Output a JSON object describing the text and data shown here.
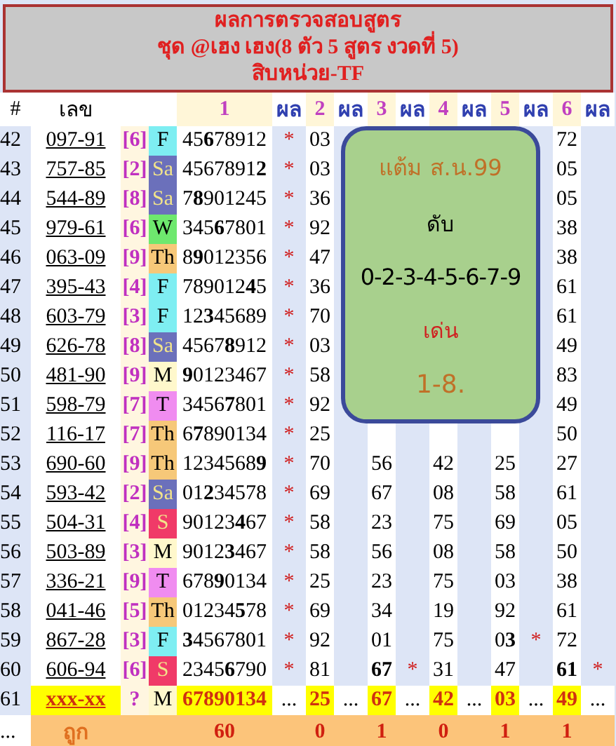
{
  "title_lines": [
    "ผลการตรวจสอบสูตร",
    "ชุด @เฮง เฮง(8 ตัว 5 สูตร งวดที่ 5)",
    "สิบหน่วย-TF"
  ],
  "header": [
    "#",
    "เลข",
    "1",
    "ผล",
    "2",
    "ผล",
    "3",
    "ผล",
    "4",
    "ผล",
    "5",
    "ผล",
    "6",
    "ผล"
  ],
  "rows": [
    {
      "kind": "result",
      "no": "42",
      "number": "097-91",
      "group": "[6]",
      "day": {
        "label": "F",
        "color": "#7eeef2"
      },
      "digits": "45**6**78912",
      "mark": "*",
      "r2": {
        "value": "03"
      },
      "r6": {
        "value": "72"
      }
    },
    {
      "kind": "result",
      "no": "43",
      "number": "757-85",
      "group": "[2]",
      "day": {
        "label": "Sa",
        "color": "#6b70bb"
      },
      "digits": "4567891**2**",
      "mark": "*",
      "r2": {
        "value": "03"
      },
      "r6": {
        "value": "05"
      }
    },
    {
      "kind": "result",
      "no": "44",
      "number": "544-89",
      "group": "[8]",
      "day": {
        "label": "Sa",
        "color": "#6b70bb"
      },
      "digits": "7**8**901245",
      "mark": "*",
      "r2": {
        "value": "36"
      },
      "r6": {
        "value": "05"
      }
    },
    {
      "kind": "result",
      "no": "45",
      "number": "979-61",
      "group": "[6]",
      "day": {
        "label": "W",
        "color": "#6ee86e"
      },
      "digits": "345**6**7801",
      "mark": "*",
      "r2": {
        "value": "92"
      },
      "r6": {
        "value": "38"
      }
    },
    {
      "kind": "result",
      "no": "46",
      "number": "063-09",
      "group": "[9]",
      "day": {
        "label": "Th",
        "color": "#f6c879"
      },
      "digits": "8**9**012356",
      "mark": "*",
      "r2": {
        "value": "47"
      },
      "r6": {
        "value": "38"
      }
    },
    {
      "kind": "result",
      "no": "47",
      "number": "395-43",
      "group": "[4]",
      "day": {
        "label": "F",
        "color": "#7eeef2"
      },
      "digits": "789012**4**5",
      "mark": "*",
      "r2": {
        "value": "36"
      },
      "r6": {
        "value": "61"
      }
    },
    {
      "kind": "result",
      "no": "48",
      "number": "603-79",
      "group": "[3]",
      "day": {
        "label": "F",
        "color": "#7eeef2"
      },
      "digits": "12**3**45689",
      "mark": "*",
      "r2": {
        "value": "70"
      },
      "r6": {
        "value": "61"
      }
    },
    {
      "kind": "result",
      "no": "49",
      "number": "626-78",
      "group": "[8]",
      "day": {
        "label": "Sa",
        "color": "#6b70bb"
      },
      "digits": "4567**8**912",
      "mark": "*",
      "r2": {
        "value": "03"
      },
      "r6": {
        "value": "49"
      }
    },
    {
      "kind": "result",
      "no": "50",
      "number": "481-90",
      "group": "[9]",
      "day": {
        "label": "M",
        "color": "#fff8cc"
      },
      "digits": "**9**0123467",
      "mark": "*",
      "r2": {
        "value": "58"
      },
      "r6": {
        "value": "83"
      }
    },
    {
      "kind": "result",
      "no": "51",
      "number": "598-79",
      "group": "[7]",
      "day": {
        "label": "T",
        "color": "#f08cf0"
      },
      "digits": "3456**7**801",
      "mark": "*",
      "r2": {
        "value": "92"
      },
      "r6": {
        "value": "49"
      }
    },
    {
      "kind": "result",
      "no": "52",
      "number": "116-17",
      "group": "[7]",
      "day": {
        "label": "Th",
        "color": "#f6c879"
      },
      "digits": "6**7**890134",
      "mark": "*",
      "r2": {
        "value": "25"
      },
      "r6": {
        "value": "50"
      }
    },
    {
      "kind": "result",
      "no": "53",
      "number": "690-60",
      "group": "[9]",
      "day": {
        "label": "Th",
        "color": "#f6c879"
      },
      "digits": "1234568**9**",
      "mark": "*",
      "r2": {
        "value": "70"
      },
      "r3": {
        "value": "56"
      },
      "r4": {
        "value": "42"
      },
      "r5": {
        "value": "25"
      },
      "r6": {
        "value": "27"
      }
    },
    {
      "kind": "result",
      "no": "54",
      "number": "593-42",
      "group": "[2]",
      "day": {
        "label": "Sa",
        "color": "#6b70bb"
      },
      "digits": "01**2**34578",
      "mark": "*",
      "r2": {
        "value": "69"
      },
      "r3": {
        "value": "67"
      },
      "r4": {
        "value": "08"
      },
      "r5": {
        "value": "58"
      },
      "r6": {
        "value": "61"
      }
    },
    {
      "kind": "result",
      "no": "55",
      "number": "504-31",
      "group": "[4]",
      "day": {
        "label": "S",
        "color": "#f03a68"
      },
      "digits": "90123**4**67",
      "mark": "*",
      "r2": {
        "value": "58"
      },
      "r3": {
        "value": "23"
      },
      "r4": {
        "value": "75"
      },
      "r5": {
        "value": "69"
      },
      "r6": {
        "value": "05"
      }
    },
    {
      "kind": "result",
      "no": "56",
      "number": "503-89",
      "group": "[3]",
      "day": {
        "label": "M",
        "color": "#fff8cc"
      },
      "digits": "9012**3**467",
      "mark": "*",
      "r2": {
        "value": "58"
      },
      "r3": {
        "value": "56"
      },
      "r4": {
        "value": "08"
      },
      "r5": {
        "value": "58"
      },
      "r6": {
        "value": "50"
      }
    },
    {
      "kind": "result",
      "no": "57",
      "number": "336-21",
      "group": "[9]",
      "day": {
        "label": "T",
        "color": "#f08cf0"
      },
      "digits": "678**9**0134",
      "mark": "*",
      "r2": {
        "value": "25"
      },
      "r3": {
        "value": "23"
      },
      "r4": {
        "value": "75"
      },
      "r5": {
        "value": "03"
      },
      "r6": {
        "value": "38"
      }
    },
    {
      "kind": "result",
      "no": "58",
      "number": "041-46",
      "group": "[5]",
      "day": {
        "label": "Th",
        "color": "#f6c879"
      },
      "digits": "01234**5**78",
      "mark": "*",
      "r2": {
        "value": "69"
      },
      "r3": {
        "value": "34"
      },
      "r4": {
        "value": "19"
      },
      "r5": {
        "value": "92"
      },
      "r6": {
        "value": "61"
      }
    },
    {
      "kind": "result",
      "no": "59",
      "number": "867-28",
      "group": "[3]",
      "day": {
        "label": "F",
        "color": "#7eeef2"
      },
      "digits": "**3**4567801",
      "mark": "*",
      "r2": {
        "value": "92"
      },
      "r3": {
        "value": "01"
      },
      "r4": {
        "value": "75"
      },
      "r5": {
        "value": "0**3**",
        "mark": "*"
      },
      "r6": {
        "value": "72"
      }
    },
    {
      "kind": "result",
      "no": "60",
      "number": "606-94",
      "group": "[6]",
      "day": {
        "label": "S",
        "color": "#f03a68"
      },
      "digits": "2345**6**790",
      "mark": "*",
      "r2": {
        "value": "81"
      },
      "r3": {
        "value": "**67**",
        "mark": "*"
      },
      "r4": {
        "value": "31"
      },
      "r5": {
        "value": "47"
      },
      "r6": {
        "value": "**61**",
        "mark": "*"
      }
    },
    {
      "kind": "pending",
      "no": "61",
      "number": "xxx-xx",
      "group": "?",
      "day": {
        "label": "M",
        "color": "#fff8cc"
      },
      "digits": "67890134",
      "mark": "...",
      "r2": {
        "value": "25",
        "mark": "..."
      },
      "r3": {
        "value": "67",
        "mark": "..."
      },
      "r4": {
        "value": "42",
        "mark": "..."
      },
      "r5": {
        "value": "03",
        "mark": "..."
      },
      "r6": {
        "value": "49",
        "mark": "..."
      }
    },
    {
      "kind": "summary",
      "no": "...",
      "label": "ถูก",
      "digits": "60",
      "r2": {
        "value": "0"
      },
      "r3": {
        "value": "1"
      },
      "r4": {
        "value": "0"
      },
      "r5": {
        "value": "1"
      },
      "r6": {
        "value": "1"
      }
    }
  ],
  "note": {
    "title": "แต้ม ส.น.99",
    "off_label": "ดับ",
    "off_digits": "0-2-3-4-5-6-7-9",
    "hot_label": "เด่น",
    "hot_digits": "1-8."
  }
}
